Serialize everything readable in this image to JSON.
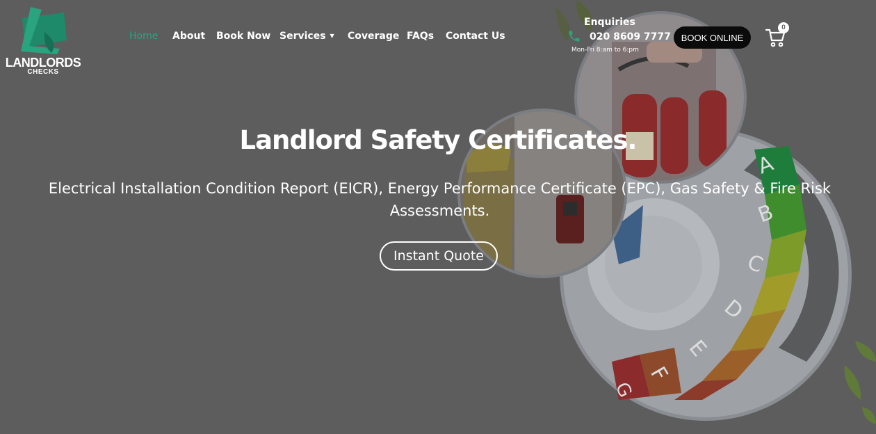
{
  "logo": {
    "wordmark": "LANDLORDS",
    "sub": "CHECKS"
  },
  "nav": {
    "home": "Home",
    "about": "About",
    "book_now": "Book Now",
    "services": "Services",
    "coverage": "Coverage",
    "faqs": "FAQs",
    "contact": "Contact Us"
  },
  "contact": {
    "label": "Enquiries",
    "phone": "020 8609 7777",
    "hours": "Mon-Fri 8:am to 6:pm"
  },
  "header": {
    "book_online": "BOOK ONLINE",
    "cart_count": "0"
  },
  "hero": {
    "title": "Landlord Safety Certificates.",
    "subtitle": "Electrical Installation Condition Report (EICR), Energy Performance Certificate (EPC), Gas Safety & Fire Risk Assessments.",
    "cta": "Instant Quote"
  },
  "epc_bands": [
    "A",
    "B",
    "C",
    "D",
    "E",
    "F",
    "G"
  ],
  "colors": {
    "brand": "#2aa37f",
    "background": "#5d5d5e",
    "button": "#0b0b0b"
  },
  "icons": [
    "phone-icon",
    "cart-icon",
    "chevron-down-icon"
  ]
}
